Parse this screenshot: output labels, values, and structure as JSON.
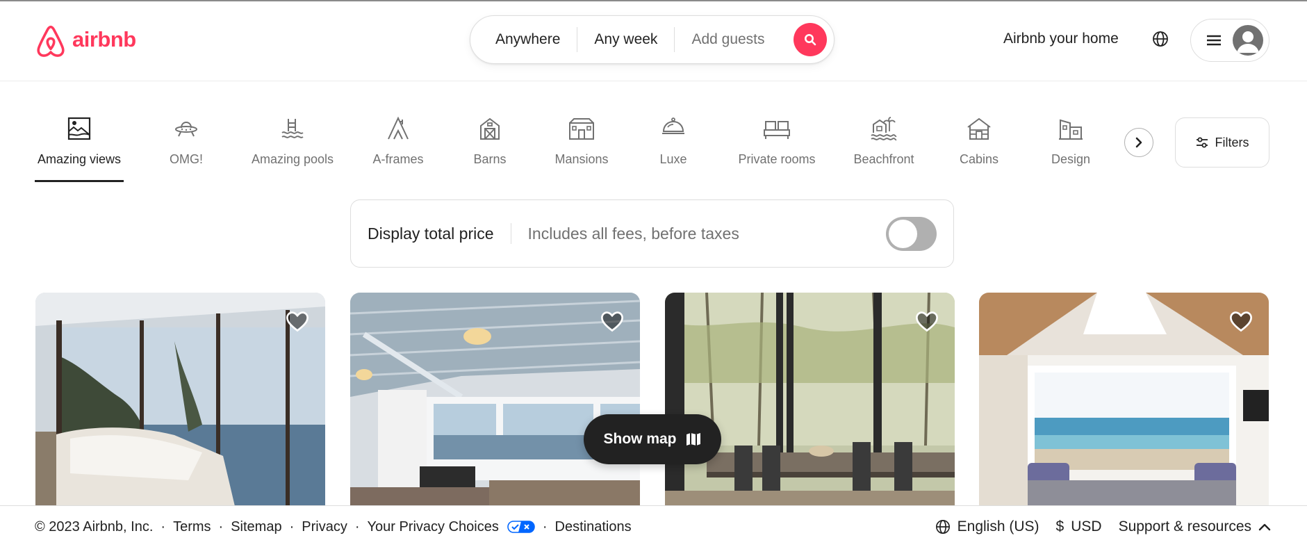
{
  "brand": {
    "name": "airbnb",
    "color": "#FF385C"
  },
  "search": {
    "location": "Anywhere",
    "dates": "Any week",
    "guests_placeholder": "Add guests"
  },
  "header": {
    "host_link": "Airbnb your home",
    "globe_icon": "globe-icon",
    "menu_icon": "menu-icon",
    "avatar_icon": "user-avatar-icon"
  },
  "categories": [
    {
      "label": "Amazing views",
      "icon": "amazing-views-icon",
      "active": true
    },
    {
      "label": "OMG!",
      "icon": "ufo-icon",
      "active": false
    },
    {
      "label": "Amazing pools",
      "icon": "pool-icon",
      "active": false
    },
    {
      "label": "A-frames",
      "icon": "a-frame-icon",
      "active": false
    },
    {
      "label": "Barns",
      "icon": "barn-icon",
      "active": false
    },
    {
      "label": "Mansions",
      "icon": "mansion-icon",
      "active": false
    },
    {
      "label": "Luxe",
      "icon": "luxe-icon",
      "active": false
    },
    {
      "label": "Private rooms",
      "icon": "bed-icon",
      "active": false
    },
    {
      "label": "Beachfront",
      "icon": "beachfront-icon",
      "active": false
    },
    {
      "label": "Cabins",
      "icon": "cabin-icon",
      "active": false
    },
    {
      "label": "Design",
      "icon": "design-icon",
      "active": false
    }
  ],
  "filters": {
    "label": "Filters"
  },
  "total_price": {
    "title": "Display total price",
    "subtitle": "Includes all fees, before taxes",
    "enabled": false
  },
  "listings": [
    {
      "scene": "bedroom-with-ocean-view-and-trees",
      "favorited": false
    },
    {
      "scene": "cottage-bedroom-with-bay-view",
      "favorited": false
    },
    {
      "scene": "dining-room-with-forest-view",
      "favorited": false
    },
    {
      "scene": "a-frame-living-room-with-ocean-view",
      "favorited": false
    }
  ],
  "show_map": {
    "label": "Show map"
  },
  "footer": {
    "copyright": "© 2023 Airbnb, Inc.",
    "links": [
      "Terms",
      "Sitemap",
      "Privacy",
      "Your Privacy Choices",
      "Destinations"
    ],
    "language": "English (US)",
    "currency_symbol": "$",
    "currency": "USD",
    "support": "Support & resources"
  }
}
